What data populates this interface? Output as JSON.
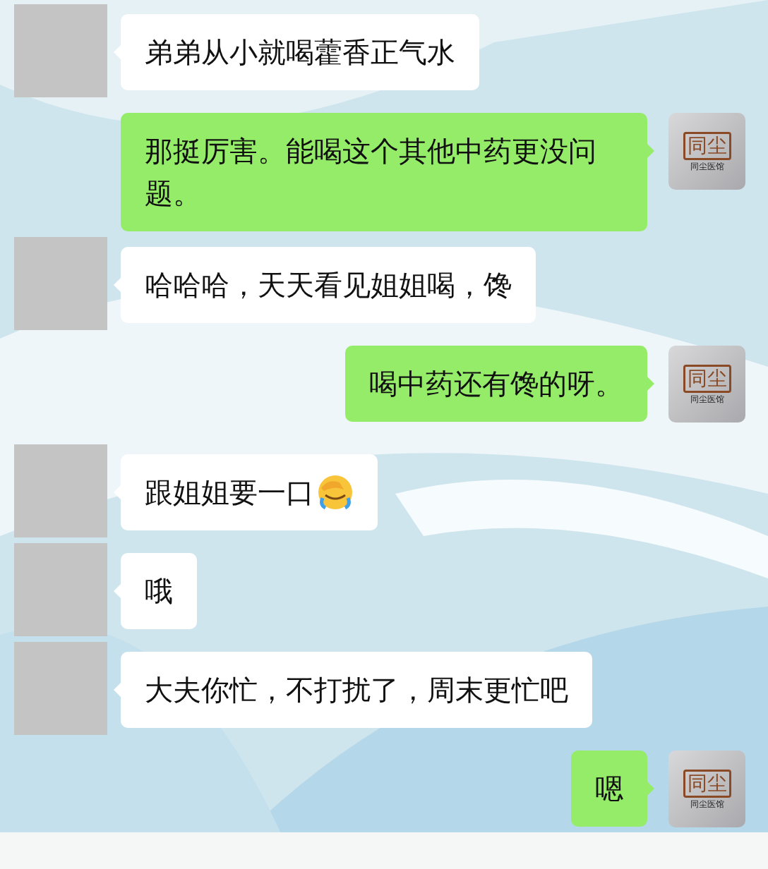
{
  "messages": [
    {
      "kind": "incoming",
      "text": "弟弟从小就喝藿香正气水"
    },
    {
      "kind": "outgoing",
      "text": "那挺厉害。能喝这个其他中药更没问题。",
      "avatar": {
        "logo": "同尘",
        "caption": "同尘医馆"
      }
    },
    {
      "kind": "incoming",
      "text": "哈哈哈，天天看见姐姐喝，馋"
    },
    {
      "kind": "outgoing",
      "text": "喝中药还有馋的呀。",
      "avatar": {
        "logo": "同尘",
        "caption": "同尘医馆"
      }
    },
    {
      "kind": "incoming",
      "text": "跟姐姐要一口",
      "has_emoji": true
    },
    {
      "kind": "incoming",
      "text": "哦"
    },
    {
      "kind": "incoming",
      "text": "大夫你忙，不打扰了，周末更忙吧"
    },
    {
      "kind": "outgoing",
      "text": "嗯",
      "avatar": {
        "logo": "同尘",
        "caption": "同尘医馆"
      }
    }
  ]
}
